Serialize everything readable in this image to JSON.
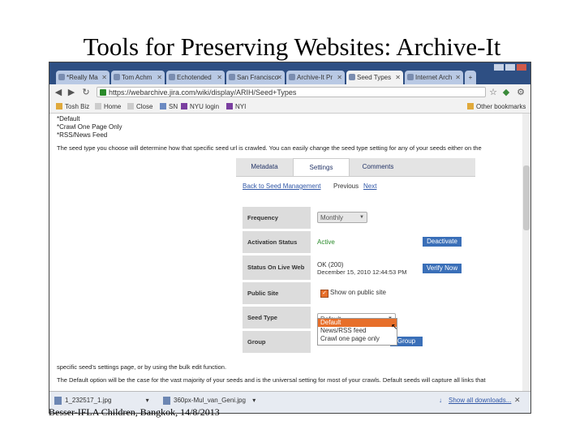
{
  "slide": {
    "title": "Tools for Preserving Websites: Archive-It",
    "footer": "Besser-IFLA Children, Bangkok, 14/8/2013"
  },
  "browser": {
    "tabs": [
      {
        "label": "*Really Ma",
        "active": false
      },
      {
        "label": "Tom Achm",
        "active": false
      },
      {
        "label": "Echotended",
        "active": false
      },
      {
        "label": "San Francisco",
        "active": false
      },
      {
        "label": "Archive-It Pr",
        "active": false
      },
      {
        "label": "Seed Types",
        "active": true
      },
      {
        "label": "Internet Arch",
        "active": false
      }
    ],
    "url": "https://webarchive.jira.com/wiki/display/ARIH/Seed+Types",
    "bookmarks": [
      "Tosh Biz",
      "Home",
      "Close",
      "SN",
      "NYU login",
      "NYI"
    ],
    "other_bookmarks": "Other bookmarks",
    "downloads": [
      {
        "name": "1_232517_1.jpg"
      },
      {
        "name": "360px-Mul_van_Geni.jpg"
      }
    ],
    "show_all_downloads": "Show all downloads..."
  },
  "page": {
    "intro_lines": [
      "*Default",
      "*Crawl One Page Only",
      "*RSS/News Feed"
    ],
    "paragraph1": "The seed type you choose will determine how that specific seed url is crawled. You can easily change the seed type setting for any of your seeds either on the",
    "paragraph2_a": "specific seed's settings page, or by using the bulk edit function.",
    "paragraph3": "The Default option will be the case for the vast majority of your seeds and is the universal setting for most of your crawls. Default seeds will capture all links that"
  },
  "panel": {
    "tabs": [
      "Metadata",
      "Settings",
      "Comments"
    ],
    "active_tab": "Settings",
    "back_link": "Back to Seed Management",
    "previous": "Previous",
    "next": "Next",
    "rows": {
      "frequency": {
        "label": "Frequency",
        "value": "Monthly"
      },
      "activation": {
        "label": "Activation Status",
        "value": "Active",
        "button": "Deactivate"
      },
      "live": {
        "label": "Status On Live Web",
        "value_line1": "OK (200)",
        "value_line2": "December 15, 2010 12:44:53 PM",
        "button": "Verify Now"
      },
      "public": {
        "label": "Public Site",
        "checkbox_label": "Show on public site",
        "checked": true
      },
      "seed_type": {
        "label": "Seed Type",
        "value": "Default"
      },
      "group": {
        "label": "Group",
        "button": "Group"
      }
    },
    "seed_type_options": [
      "Default",
      "News/RSS feed",
      "Crawl one page only"
    ],
    "highlighted_option": "Default"
  },
  "colors": {
    "tabstrip": "#2e4f83",
    "link": "#2f56a6",
    "button": "#3a6fb8",
    "highlight": "#e76f2a",
    "active_status": "#2a8a2a"
  }
}
